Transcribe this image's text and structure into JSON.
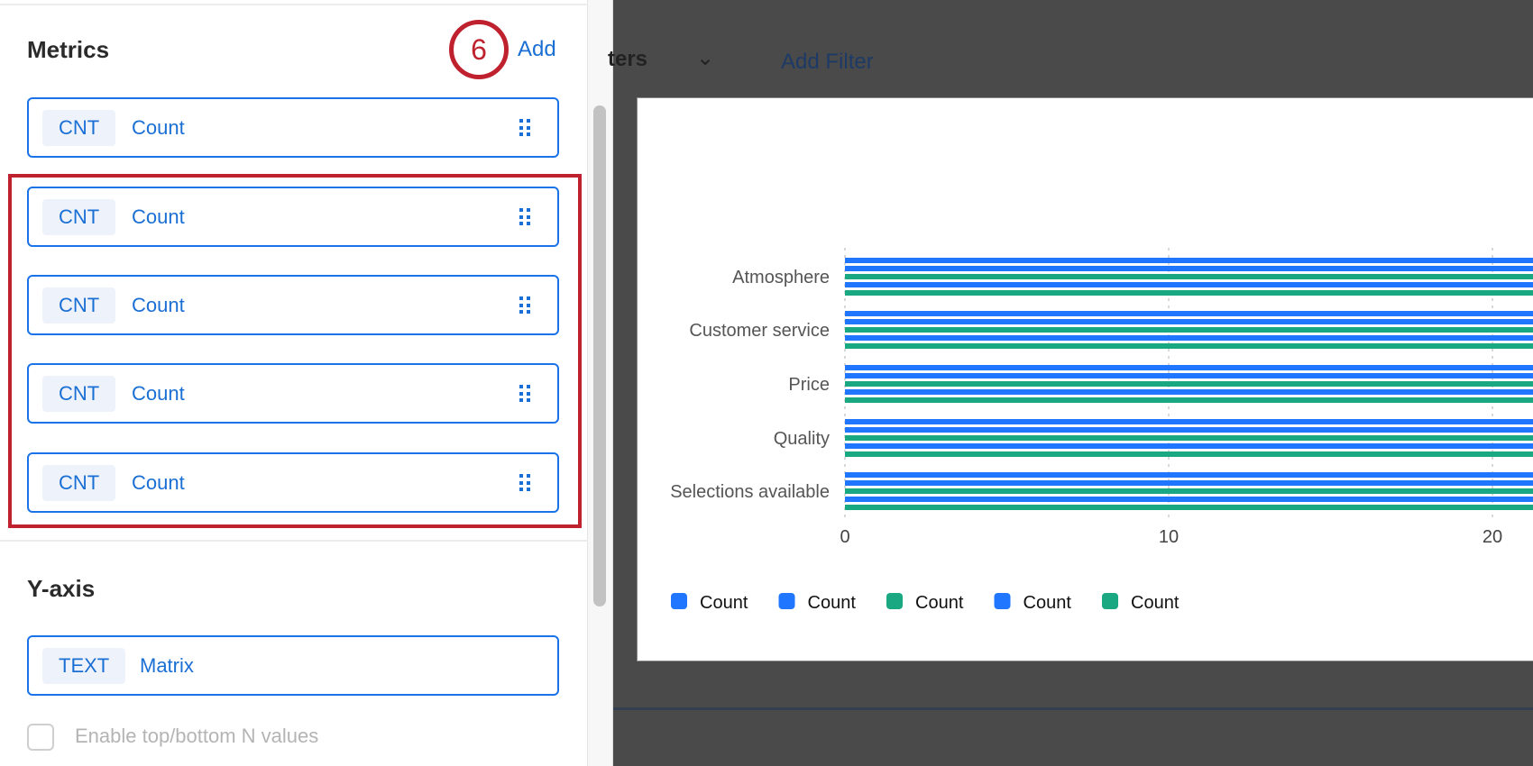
{
  "panel": {
    "metrics_title": "Metrics",
    "step_badge": "6",
    "add_label": "Add",
    "metrics": [
      {
        "type": "CNT",
        "label": "Count"
      },
      {
        "type": "CNT",
        "label": "Count"
      },
      {
        "type": "CNT",
        "label": "Count"
      },
      {
        "type": "CNT",
        "label": "Count"
      },
      {
        "type": "CNT",
        "label": "Count"
      }
    ],
    "yaxis_title": "Y-axis",
    "yaxis_field": {
      "type": "TEXT",
      "label": "Matrix"
    },
    "topn_label": "Enable top/bottom N values"
  },
  "overlay": {
    "filters_label": "ters",
    "add_filter": "Add Filter"
  },
  "colors": {
    "blue": "#2176ff",
    "green": "#1aa883",
    "accent": "#1a6fd4",
    "highlight": "#c0212e"
  },
  "chart_data": {
    "type": "bar",
    "orientation": "horizontal",
    "categories": [
      "Atmosphere",
      "Customer service",
      "Price",
      "Quality",
      "Selections available"
    ],
    "series": [
      {
        "name": "Count",
        "color": "#2176ff",
        "values": [
          25,
          25,
          25,
          25,
          25
        ]
      },
      {
        "name": "Count",
        "color": "#2176ff",
        "values": [
          25,
          25,
          25,
          25,
          25
        ]
      },
      {
        "name": "Count",
        "color": "#1aa883",
        "values": [
          25,
          25,
          25,
          25,
          25
        ]
      },
      {
        "name": "Count",
        "color": "#2176ff",
        "values": [
          25,
          25,
          25,
          25,
          25
        ]
      },
      {
        "name": "Count",
        "color": "#1aa883",
        "values": [
          25,
          25,
          25,
          25,
          25
        ]
      }
    ],
    "xticks": [
      "0",
      "10",
      "20"
    ],
    "xtick_values": [
      0,
      10,
      20
    ],
    "legend_position": "bottom-left",
    "grid": true
  }
}
